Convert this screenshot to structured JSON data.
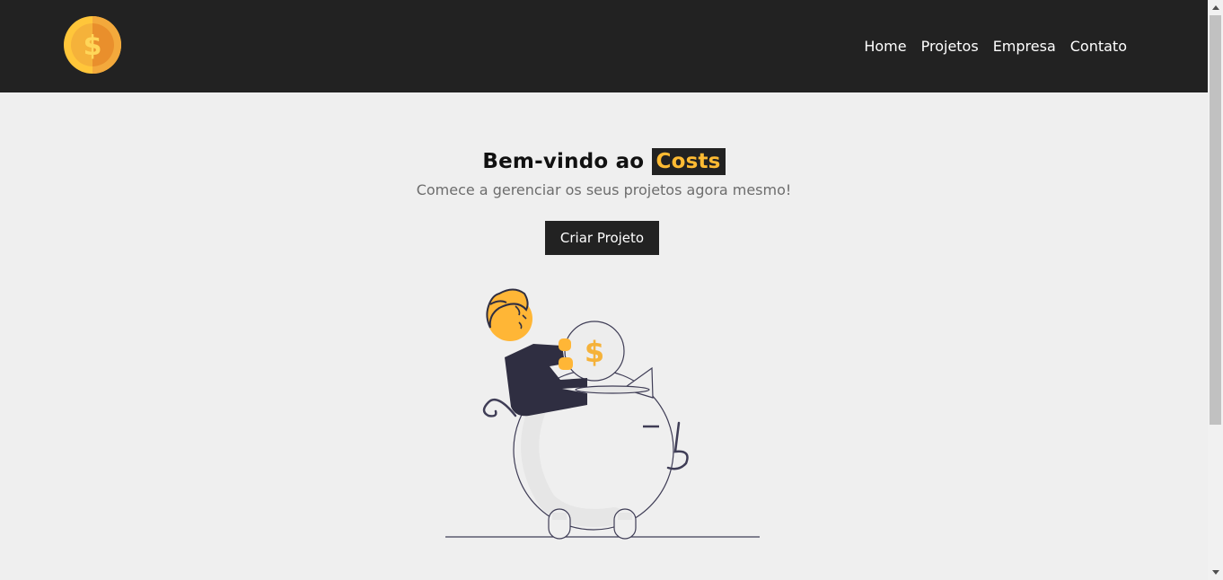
{
  "nav": {
    "logo_icon": "dollar-coin-icon",
    "links": [
      "Home",
      "Projetos",
      "Empresa",
      "Contato"
    ]
  },
  "hero": {
    "title_prefix": "Bem-vindo ao",
    "title_highlight": "Costs",
    "subtitle": "Comece a gerenciar os seus projetos agora mesmo!",
    "cta_label": "Criar Projeto",
    "illustration_icon": "piggy-bank-savings-illustration"
  },
  "colors": {
    "navbar_bg": "#222222",
    "page_bg": "#efefef",
    "accent": "#ffbb33",
    "button_bg": "#222222",
    "subtitle_text": "#6d6d6d"
  }
}
